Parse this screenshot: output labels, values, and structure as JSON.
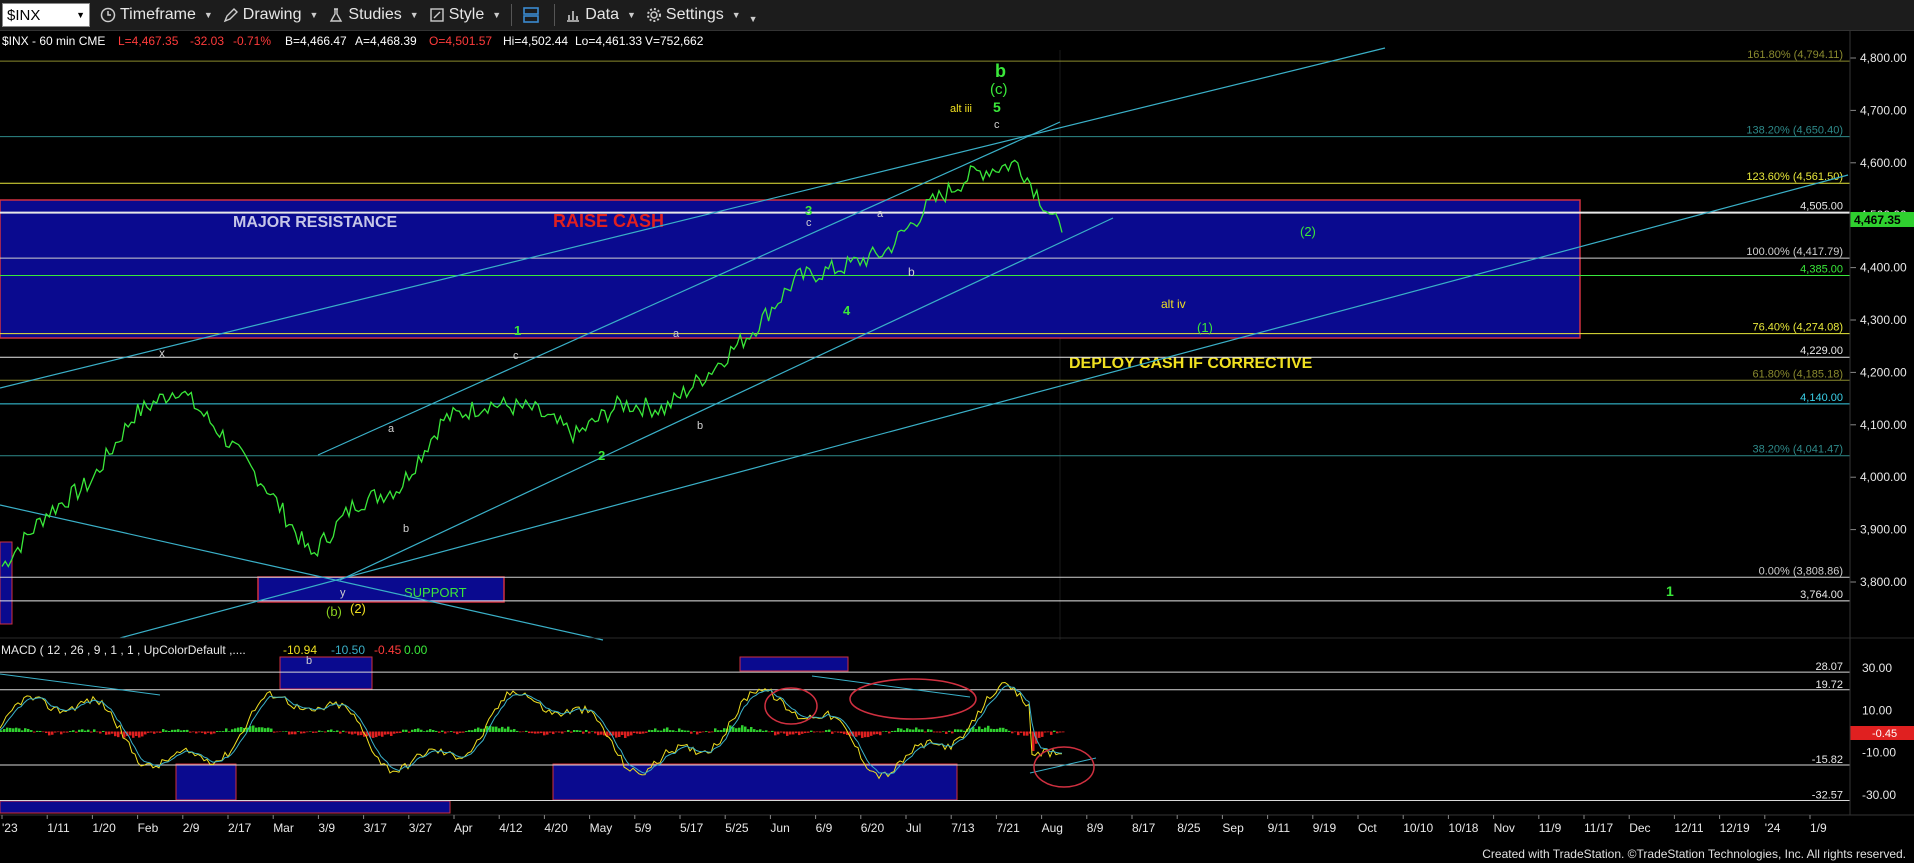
{
  "toolbar": {
    "symbol": "$INX",
    "timeframe": "Timeframe",
    "drawing": "Drawing",
    "studies": "Studies",
    "style": "Style",
    "data": "Data",
    "settings": "Settings"
  },
  "info": {
    "symbol_line": "$INX - 60 min  CME",
    "last": "L=4,467.35",
    "change": "-32.03",
    "change_pct": "-0.71%",
    "bid": "B=4,466.47",
    "ask": "A=4,468.39",
    "open": "O=4,501.57",
    "high": "Hi=4,502.44",
    "low": "Lo=4,461.33",
    "volume": "V=752,662"
  },
  "price_axis": {
    "ticks": [
      "4,800.00",
      "4,700.00",
      "4,600.00",
      "4,500.00",
      "4,400.00",
      "4,300.00",
      "4,200.00",
      "4,100.00",
      "4,000.00",
      "3,900.00",
      "3,800.00"
    ],
    "last_tag": "4,467.35"
  },
  "levels": [
    {
      "label": "161.80% (4,794.11)",
      "price": 4794,
      "color": "#8a8a2e"
    },
    {
      "label": "138.20% (4,650.40)",
      "price": 4650,
      "color": "#2e8a8a"
    },
    {
      "label": "123.60% (4,561.50)",
      "price": 4561,
      "color": "#e8e83a"
    },
    {
      "label": "4,505.00",
      "price": 4505,
      "color": "#e8e8e8"
    },
    {
      "label": "100.00% (4,417.79)",
      "price": 4418,
      "color": "#d0d0d0"
    },
    {
      "label": "4,385.00",
      "price": 4385,
      "color": "#3ae83a"
    },
    {
      "label": "76.40% (4,274.08)",
      "price": 4274,
      "color": "#e8e83a"
    },
    {
      "label": "4,229.00",
      "price": 4229,
      "color": "#e8e8e8"
    },
    {
      "label": "61.80% (4,185.18)",
      "price": 4185,
      "color": "#8a8a2e"
    },
    {
      "label": "4,140.00",
      "price": 4140,
      "color": "#3ad0e8"
    },
    {
      "label": "38.20% (4,041.47)",
      "price": 4041,
      "color": "#2e8a8a"
    },
    {
      "label": "0.00% (3,808.86)",
      "price": 3809,
      "color": "#d0d0d0"
    },
    {
      "label": "3,764.00",
      "price": 3764,
      "color": "#e8e8e8"
    }
  ],
  "zones": {
    "resistance": "MAJOR RESISTANCE",
    "raise_cash": "RAISE CASH",
    "deploy_cash": "DEPLOY CASH IF CORRECTIVE",
    "support": "SUPPORT"
  },
  "wave_labels": {
    "b_big": "b",
    "c_paren": "(c)",
    "five": "5",
    "c_small_top": "c",
    "alt_iii": "alt iii",
    "three": "3",
    "c_mid": "c",
    "a_jul": "a",
    "b_jul": "b",
    "four": "4",
    "alt_iv": "alt iv",
    "wave2_paren": "(2)",
    "wave1_paren": "(1)",
    "one_apr": "1",
    "c_apr": "c",
    "a_may": "a",
    "b_may": "b",
    "two_may": "2",
    "x_feb": "x",
    "a_mar": "a",
    "b_mar": "b",
    "y_mar": "y",
    "b_paren": "(b)",
    "two_paren": "(2)",
    "one_nov": "1"
  },
  "macd": {
    "title": "MACD ( 12 , 26 , 9 , 1 , 1 , UpColorDefault ,....",
    "v1": "-10.94",
    "v2": "-10.50",
    "v3": "-0.45",
    "v4": "0.00",
    "ticks": [
      "30.00",
      "10.00",
      "-10.00",
      "-30.00"
    ],
    "level_labels": [
      "28.07",
      "19.72",
      "-15.82",
      "-32.57"
    ],
    "last_tag": "-0.45",
    "b_label": "b",
    "a_label": "a"
  },
  "time_axis": [
    "'23",
    "1/11",
    "1/20",
    "Feb",
    "2/9",
    "2/17",
    "Mar",
    "3/9",
    "3/17",
    "3/27",
    "Apr",
    "4/12",
    "4/20",
    "May",
    "5/9",
    "5/17",
    "5/25",
    "Jun",
    "6/9",
    "6/20",
    "Jul",
    "7/13",
    "7/21",
    "Aug",
    "8/9",
    "8/17",
    "8/25",
    "Sep",
    "9/11",
    "9/19",
    "Oct",
    "10/10",
    "10/18",
    "Nov",
    "11/9",
    "11/17",
    "Dec",
    "12/11",
    "12/19",
    "'24",
    "1/9"
  ],
  "footer": "Created with TradeStation. ©TradeStation Technologies, Inc. All rights reserved.",
  "chart_data": {
    "type": "line",
    "title": "$INX - 60 min",
    "x": [
      "'23",
      "1/11",
      "1/20",
      "Feb",
      "2/9",
      "2/17",
      "Mar",
      "3/9",
      "3/17",
      "3/27",
      "Apr",
      "4/12",
      "4/20",
      "May",
      "5/9",
      "5/17",
      "5/25",
      "Jun",
      "6/9",
      "6/20",
      "Jul",
      "7/13",
      "7/21",
      "Aug",
      "8/9"
    ],
    "series": [
      {
        "values": [
          3830,
          3930,
          3990,
          4120,
          4170,
          4080,
          3980,
          3850,
          3950,
          3980,
          4110,
          4140,
          4130,
          4080,
          4140,
          4130,
          4200,
          4280,
          4380,
          4400,
          4430,
          4520,
          4580,
          4600,
          4467
        ]
      }
    ],
    "ylim": [
      3700,
      4830
    ],
    "grid": false
  }
}
